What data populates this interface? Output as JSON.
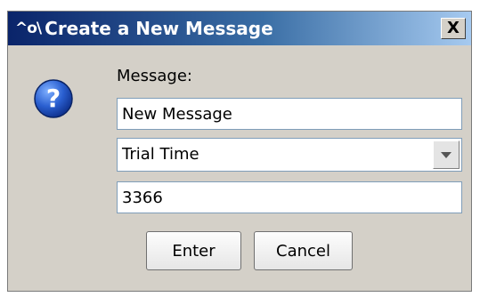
{
  "window": {
    "icon": "wave-signal-icon",
    "icon_glyph": "^o\\",
    "title": "Create a New Message",
    "close_glyph": "X"
  },
  "dialog": {
    "icon": "question-mark-icon",
    "message_label": "Message:",
    "message_name_value": "New Message",
    "type_select": {
      "selected": "Trial Time"
    },
    "number_value": "3366"
  },
  "buttons": {
    "enter_label": "Enter",
    "cancel_label": "Cancel"
  },
  "colors": {
    "title_start": "#0a246a",
    "title_end": "#a6caf0",
    "dialog_bg": "#d4d0c8",
    "icon_blue": "#1c4fb5"
  }
}
